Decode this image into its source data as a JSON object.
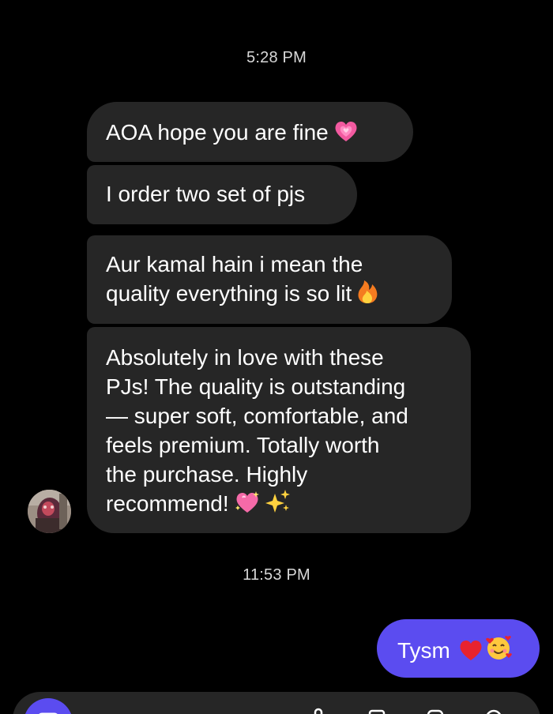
{
  "conversation": {
    "timestamps": [
      "5:28 PM",
      "11:53 PM"
    ],
    "incoming": [
      {
        "text": "AOA hope you are fine",
        "emoji": "growing-heart"
      },
      {
        "text": "I order two set of pjs"
      },
      {
        "text": "Aur kamal hain i mean the\nquality everything is so lit",
        "emoji": "fire"
      },
      {
        "text": "Absolutely in love with these\nPJs! The quality is outstanding\n— super soft, comfortable, and\nfeels premium. Totally worth\nthe purchase. Highly\nrecommend!",
        "emojis": [
          "sparkling-heart",
          "sparkles"
        ]
      }
    ],
    "outgoing": [
      {
        "text": "Tysm",
        "emojis": [
          "red-heart",
          "smiling-face-with-hearts"
        ]
      }
    ]
  },
  "colors": {
    "background": "#000000",
    "incoming_bubble": "#262626",
    "outgoing_bubble": "#5b4cf0",
    "timestamp": "#d8d8d8"
  },
  "icons": [
    "avatar-photo",
    "growing-heart-emoji",
    "fire-emoji",
    "sparkling-heart-emoji",
    "sparkles-emoji",
    "red-heart-emoji",
    "smiling-face-with-hearts-emoji",
    "camera-icon",
    "mic-icon",
    "gallery-icon",
    "sticker-icon"
  ]
}
